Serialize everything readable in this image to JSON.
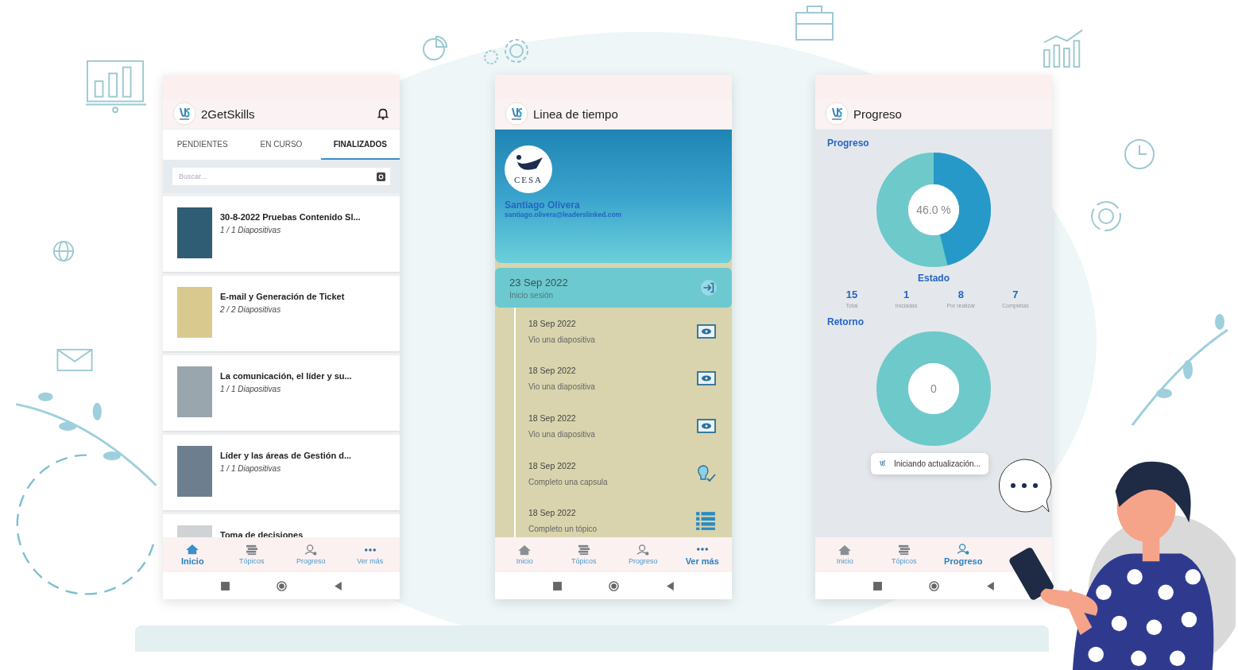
{
  "screens": [
    {
      "kind": "courses",
      "title": "2GetSkills",
      "tabs": [
        {
          "label": "PENDIENTES",
          "selected": false
        },
        {
          "label": "EN CURSO",
          "selected": false
        },
        {
          "label": "FINALIZADOS",
          "selected": true
        }
      ],
      "search": {
        "placeholder": "Buscar..."
      },
      "courses": [
        {
          "title": "30-8-2022 Pruebas Contenido Sl...",
          "slides": "1 / 1 Diapositivas"
        },
        {
          "title": "E-mail y Generación de Ticket",
          "slides": "2 / 2 Diapositivas"
        },
        {
          "title": "La comunicación, el líder y su...",
          "slides": "1 / 1 Diapositivas"
        },
        {
          "title": "Líder y las áreas de Gestión d...",
          "slides": "1 / 1 Diapositivas"
        },
        {
          "title": "Toma de decisiones"
        }
      ],
      "nav": [
        {
          "label": "Inicio",
          "kind": "home",
          "selected": true
        },
        {
          "label": "Tópicos",
          "kind": "topics",
          "selected": false
        },
        {
          "label": "Progreso",
          "kind": "progress",
          "selected": false
        },
        {
          "label": "Ver más",
          "kind": "more",
          "selected": false
        }
      ]
    },
    {
      "kind": "timeline",
      "title": "Linea de tiempo",
      "profile": {
        "logo": "CESA",
        "name": "Santiago Olivera",
        "email": "santiago.olivera@leaderslinked.com"
      },
      "session": {
        "date": "23 Sep 2022",
        "label": "Inicio sesión"
      },
      "events": [
        {
          "date": "18 Sep 2022",
          "text": "Vio una diapositiva",
          "kind": "view"
        },
        {
          "date": "18 Sep 2022",
          "text": "Vio una diapositiva",
          "kind": "view"
        },
        {
          "date": "18 Sep 2022",
          "text": "Vio una diapositiva",
          "kind": "view"
        },
        {
          "date": "18 Sep 2022",
          "text": "Completo una capsula",
          "kind": "capsule"
        },
        {
          "date": "18 Sep 2022",
          "text": "Completo un tópico",
          "kind": "topic"
        }
      ],
      "nav": [
        {
          "label": "Inicio",
          "kind": "home",
          "selected": false
        },
        {
          "label": "Tópicos",
          "kind": "topics",
          "selected": false
        },
        {
          "label": "Progreso",
          "kind": "progress",
          "selected": false
        },
        {
          "label": "Ver más",
          "kind": "more",
          "selected": true
        }
      ]
    },
    {
      "kind": "progress",
      "title": "Progreso",
      "progress": {
        "heading": "Progreso",
        "level": 0.46,
        "reading": "46.0 %"
      },
      "status": {
        "heading": "Estado",
        "stats": [
          {
            "value": "15",
            "label": "Total"
          },
          {
            "value": "1",
            "label": "Iniciadas"
          },
          {
            "value": "8",
            "label": "Por realizar"
          },
          {
            "value": "7",
            "label": "Completas"
          }
        ]
      },
      "feedback": {
        "heading": "Retorno",
        "level": 0,
        "reading": "0"
      },
      "toast": "Iniciando actualización...",
      "nav": [
        {
          "label": "Inicio",
          "kind": "home",
          "selected": false
        },
        {
          "label": "Tópicos",
          "kind": "topics",
          "selected": false
        },
        {
          "label": "Progreso",
          "kind": "progress",
          "selected": true
        }
      ]
    }
  ]
}
